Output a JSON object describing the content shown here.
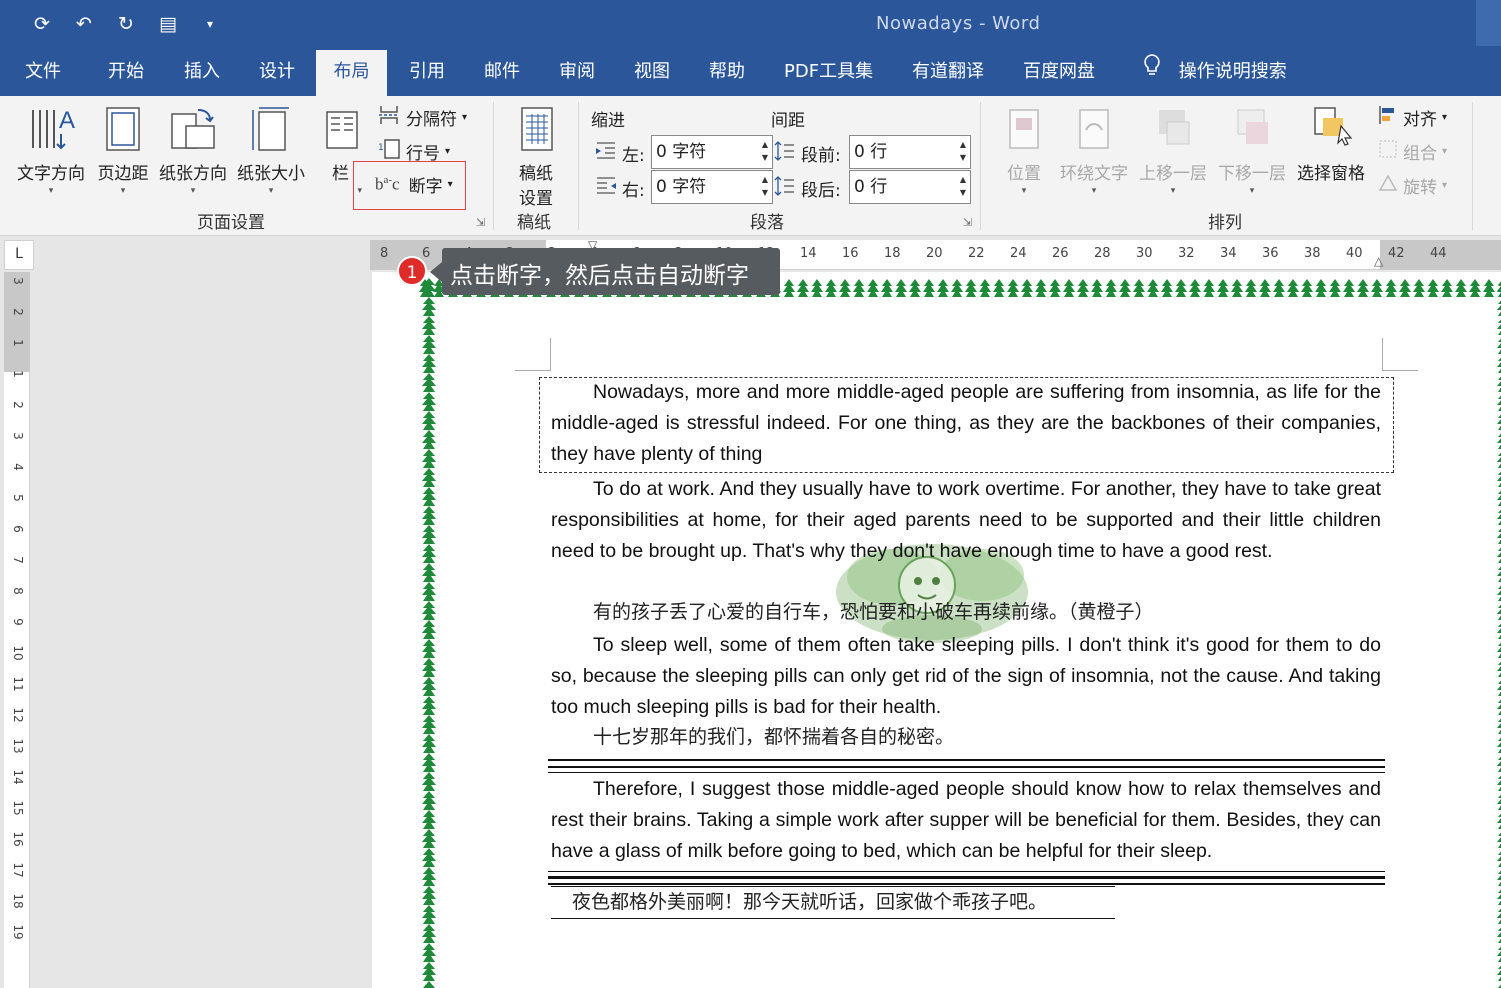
{
  "window": {
    "title": "Nowadays  -  Word"
  },
  "quick_access": [
    {
      "icon": "save-icon",
      "glyph": "⟳"
    },
    {
      "icon": "undo-icon",
      "glyph": "↶"
    },
    {
      "icon": "redo-icon",
      "glyph": "↻"
    },
    {
      "icon": "format-painter-icon",
      "glyph": "▤"
    },
    {
      "icon": "customize-icon",
      "glyph": "▾"
    }
  ],
  "tabs": [
    "文件",
    "开始",
    "插入",
    "设计",
    "布局",
    "引用",
    "邮件",
    "审阅",
    "视图",
    "帮助",
    "PDF工具集",
    "有道翻译",
    "百度网盘",
    "操作说明搜索"
  ],
  "active_tab": "布局",
  "ribbon": {
    "page_setup": {
      "group_label": "页面设置",
      "text_direction": "文字方向",
      "margins": "页边距",
      "orientation": "纸张方向",
      "size": "纸张大小",
      "columns": "栏",
      "breaks": "分隔符",
      "line_numbers": "行号",
      "hyphenation": "断字"
    },
    "manuscript": {
      "group_label": "稿纸",
      "button_line1": "稿纸",
      "button_line2": "设置"
    },
    "paragraph": {
      "group_label": "段落",
      "indent_header": "缩进",
      "spacing_header": "间距",
      "left_label": "左:",
      "left_value": "0 字符",
      "right_label": "右:",
      "right_value": "0 字符",
      "before_label": "段前:",
      "before_value": "0 行",
      "after_label": "段后:",
      "after_value": "0 行"
    },
    "arrange": {
      "group_label": "排列",
      "position": "位置",
      "wrap_text": "环绕文字",
      "bring_forward": "上移一层",
      "send_backward": "下移一层",
      "selection_pane": "选择窗格",
      "align": "对齐",
      "group": "组合",
      "rotate": "旋转"
    }
  },
  "ruler": {
    "h_ticks": [
      "8",
      "6",
      "4",
      "2",
      "2",
      "4",
      "6",
      "8",
      "10",
      "12",
      "14",
      "16",
      "18",
      "20",
      "22",
      "24",
      "26",
      "28",
      "30",
      "32",
      "34",
      "36",
      "38",
      "40",
      "42",
      "44"
    ],
    "v_ticks": [
      "3",
      "2",
      "1",
      "1",
      "2",
      "3",
      "4",
      "5",
      "6",
      "7",
      "8",
      "9",
      "10",
      "11",
      "12",
      "13",
      "14",
      "15",
      "16",
      "17",
      "18",
      "19"
    ],
    "tab_stop_glyph": "L"
  },
  "callout": {
    "badge": "1",
    "text": "点击断字，然后点击自动断字"
  },
  "document": {
    "p1": "Nowadays, more and more middle-aged people are suffering from insomnia, as life for the middle-aged is stressful indeed. For one thing, as they are the backbones of their companies, they have plenty of thing",
    "p2": "To do at work. And they usually have to work overtime. For another, they have to take great responsibilities at home, for their aged parents need to be supported and their little children need to be brought up. That's why they don't have enough time to have a good rest.",
    "cn1": "有的孩子丢了心爱的自行车，恐怕要和小破车再续前缘。（黄橙子）",
    "p3": "To sleep well, some of them often take sleeping pills. I don't think it's good for them to do so, because the sleeping pills can only get rid of the sign of insomnia, not the cause. And taking too much sleeping pills is bad for their health.",
    "cn2": "十七岁那年的我们，都怀揣着各自的秘密。",
    "p4": "Therefore, I suggest those middle-aged people should know how to relax themselves and rest their brains. Taking a simple work after supper will be beneficial for them. Besides, they can have a glass of milk before going to bed, which can be helpful for their sleep.",
    "cn3": "夜色都格外美丽啊！那今天就听话，回家做个乖孩子吧。"
  },
  "colors": {
    "title_bar": "#2b579a",
    "ribbon": "#f3f3f3",
    "highlight": "#e0424b",
    "callout": "#555b5e",
    "badge": "#e02b2b",
    "tree_border": "#1e8a3a"
  }
}
